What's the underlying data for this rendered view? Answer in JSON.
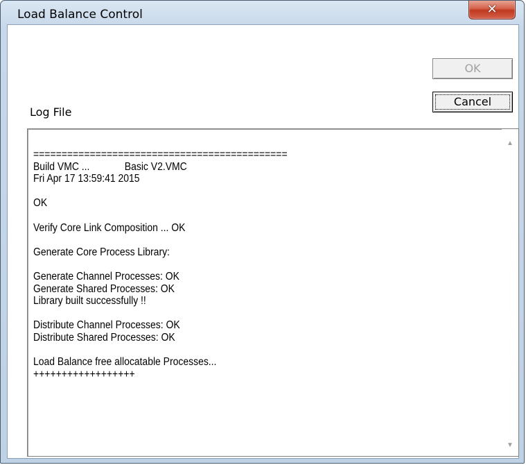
{
  "window": {
    "title": "Load Balance Control",
    "close_symbol": "✕"
  },
  "buttons": {
    "ok_label": "OK",
    "cancel_label": "Cancel"
  },
  "log": {
    "label": "Log File",
    "lines": [
      "=============================================",
      "Build VMC ...             Basic V2.VMC",
      "Fri Apr 17 13:59:41 2015",
      "",
      "OK",
      "",
      "Verify Core Link Composition ... OK",
      "",
      "Generate Core Process Library:",
      "",
      "Generate Channel Processes: OK",
      "Generate Shared Processes: OK",
      "Library built successfully !!",
      "",
      "Distribute Channel Processes: OK",
      "Distribute Shared Processes: OK",
      "",
      "Load Balance free allocatable Processes...",
      "++++++++++++++++++"
    ]
  },
  "icons": {
    "scroll_up": "▲",
    "scroll_down": "▼"
  }
}
